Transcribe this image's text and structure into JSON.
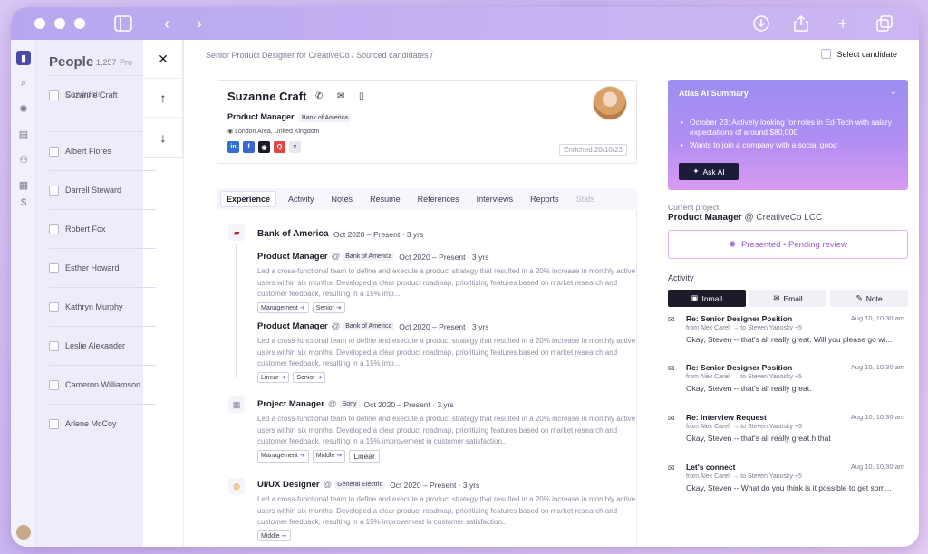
{
  "breadcrumb": "Senior Product Designer for CreativeCo / Sourced candidates /",
  "select_candidate": "Select candidate",
  "people": {
    "title": "People",
    "count": "1,257",
    "pro": "Pro",
    "header": "Candidate",
    "candidates": [
      "Suzanne Craft",
      "Albert Flores",
      "Darrell Steward",
      "Robert Fox",
      "Esther Howard",
      "Kathryn Murphy",
      "Leslie Alexander",
      "Cameron Williamson",
      "Arlene McCoy"
    ]
  },
  "profile": {
    "name": "Suzanne Craft",
    "role": "Product Manager",
    "company": "Bank of America",
    "location": "London Area, United Kingdom",
    "enriched": "Enriched 20/10/23"
  },
  "tabs": [
    "Experience",
    "Activity",
    "Notes",
    "Resume",
    "References",
    "Interviews",
    "Reports",
    "Stats"
  ],
  "experience": {
    "boa": {
      "name": "Bank of America",
      "dates": "Oct 2020 – Present · 3 yrs",
      "jobs": [
        {
          "title": "Product Manager",
          "company": "Bank of America",
          "dates": "Oct 2020 – Present · 3 yrs",
          "desc": "Led a cross-functional team to define and execute a product strategy that resulted in a 20% increase in monthly active users within six months. Developed a clear product roadmap, prioritizing features based on market research and customer feedback, resulting in a 15% imp...",
          "tags": [
            "Management",
            "Senior"
          ]
        },
        {
          "title": "Product Manager",
          "company": "Bank of America",
          "dates": "Oct 2020 – Present · 3 yrs",
          "desc": "Led a cross-functional team to define and execute a product strategy that resulted in a 20% increase in monthly active users within six months. Developed a clear product roadmap, prioritizing features based on market research and customer feedback, resulting in a 15% imp...",
          "tags": [
            "Linear",
            "Senior"
          ]
        }
      ]
    },
    "sony": {
      "title": "Project Manager",
      "company": "Sony",
      "dates": "Oct 2020 – Present · 3 yrs",
      "desc": "Led a cross-functional team to define and execute a product strategy that resulted in a 20% increase in monthly active users within six months. Developed a clear product roadmap, prioritizing features based on market research and customer feedback, resulting in a 15% improvement in customer satisfaction...",
      "tags": [
        "Management",
        "Middle"
      ],
      "tag_plain": "Linear"
    },
    "ge": {
      "title": "UI/UX Designer",
      "company": "General Electric",
      "dates": "Oct 2020 – Present · 3 yrs",
      "desc": "Led a cross-functional team to define and execute a product strategy that resulted in a 20% increase in monthly active users within six months. Developed a clear product roadmap, prioritizing features based on market research and customer feedback, resulting in a 15% improvement in customer satisfaction...",
      "tags": [
        "Middle"
      ]
    }
  },
  "summary": {
    "title": "Atlas AI Summary",
    "items": [
      "October 23: Actively looking for roles in Ed-Tech with salary expectations of around $80,000",
      "Wants to join a company with a social good"
    ],
    "ask": "Ask AI"
  },
  "current_project": {
    "label": "Current project",
    "title": "Product Manager",
    "company": "@ CreativeCo LCC",
    "status": "Presented • Pending review"
  },
  "activity": {
    "label": "Activity",
    "tabs": [
      "Inmail",
      "Email",
      "Note"
    ],
    "messages": [
      {
        "subject": "Re: Senior Designer Position",
        "date": "Aug 10, 10:30 am",
        "from": "from Alex Carell",
        "to": "to Steven Yanosky +5",
        "body": "Okay, Steven -- that's all really great. Will you please go wi..."
      },
      {
        "subject": "Re: Senior Designer Position",
        "date": "Aug 10, 10:30 am",
        "from": "from Alex Carell",
        "to": "to Steven Yanosky +5",
        "body": "Okay, Steven -- that's all really great."
      },
      {
        "subject": "Re: Interview Request",
        "date": "Aug 10, 10:30 am",
        "from": "from Alex Carell",
        "to": "to Steven Yanosky +5",
        "body": "Okay, Steven -- that's all really great.h that"
      },
      {
        "subject": "Let's connect",
        "date": "Aug 10, 10:30 am",
        "from": "from Alex Carell",
        "to": "to Steven Yanosky +5",
        "body": "Okay, Steven -- What do you think is it possible to get som..."
      }
    ]
  },
  "colors": {
    "accent": "#9b8cf2",
    "status": "#9b5bd8",
    "titlebar": "#b8a7ef"
  }
}
